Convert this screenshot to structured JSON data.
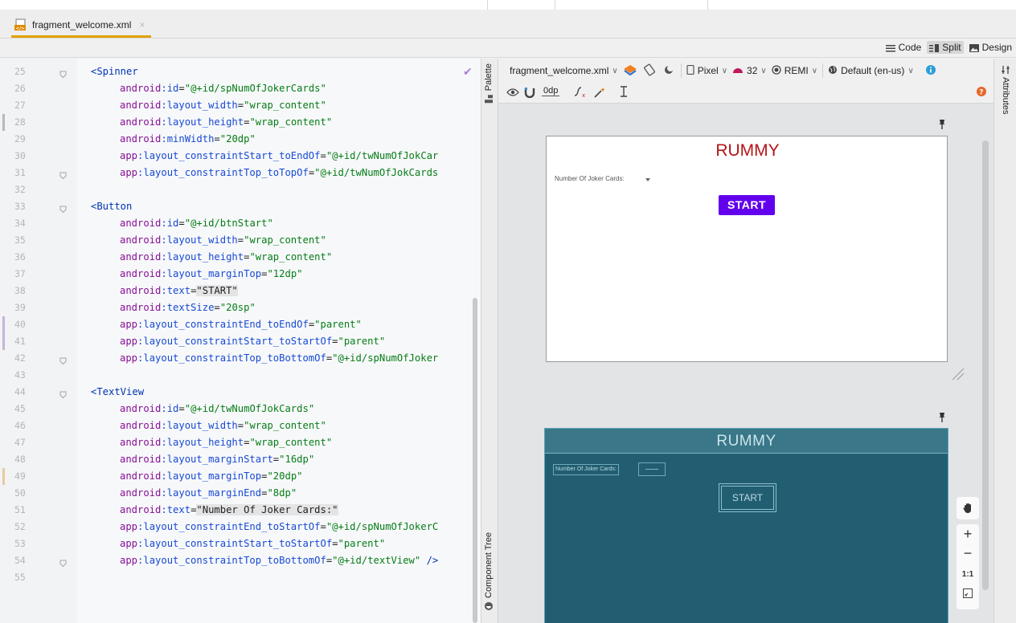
{
  "file_tab": {
    "name": "fragment_welcome.xml",
    "close": "×"
  },
  "view_modes": [
    {
      "label": "Code",
      "icon": "lines-icon",
      "active": false
    },
    {
      "label": "Split",
      "icon": "split-icon",
      "active": true
    },
    {
      "label": "Design",
      "icon": "image-icon",
      "active": false
    }
  ],
  "editor": {
    "lines": [
      {
        "n": "25",
        "parts": [
          [
            "tag",
            "<Spinner"
          ]
        ]
      },
      {
        "n": "26",
        "parts": [
          [
            "ns",
            "android"
          ],
          [
            "attr",
            ":id"
          ],
          [
            "eq",
            "="
          ],
          [
            "val",
            "\"@+id/spNumOfJokerCards\""
          ]
        ]
      },
      {
        "n": "27",
        "parts": [
          [
            "ns",
            "android"
          ],
          [
            "attr",
            ":layout_width"
          ],
          [
            "eq",
            "="
          ],
          [
            "val",
            "\"wrap_content\""
          ]
        ]
      },
      {
        "n": "28",
        "parts": [
          [
            "ns",
            "android"
          ],
          [
            "attr",
            ":layout_height"
          ],
          [
            "eq",
            "="
          ],
          [
            "val",
            "\"wrap_content\""
          ]
        ]
      },
      {
        "n": "29",
        "parts": [
          [
            "ns",
            "android"
          ],
          [
            "attr",
            ":minWidth"
          ],
          [
            "eq",
            "="
          ],
          [
            "val",
            "\"20dp\""
          ]
        ]
      },
      {
        "n": "30",
        "parts": [
          [
            "ns",
            "app"
          ],
          [
            "attr",
            ":layout_constraintStart_toEndOf"
          ],
          [
            "eq",
            "="
          ],
          [
            "val",
            "\"@+id/twNumOfJokCar"
          ]
        ]
      },
      {
        "n": "31",
        "parts": [
          [
            "ns",
            "app"
          ],
          [
            "attr",
            ":layout_constraintTop_toTopOf"
          ],
          [
            "eq",
            "="
          ],
          [
            "val",
            "\"@+id/twNumOfJokCards"
          ]
        ]
      },
      {
        "n": "32",
        "parts": []
      },
      {
        "n": "33",
        "parts": [
          [
            "tag",
            "<Button"
          ]
        ]
      },
      {
        "n": "34",
        "parts": [
          [
            "ns",
            "android"
          ],
          [
            "attr",
            ":id"
          ],
          [
            "eq",
            "="
          ],
          [
            "val",
            "\"@+id/btnStart\""
          ]
        ]
      },
      {
        "n": "35",
        "parts": [
          [
            "ns",
            "android"
          ],
          [
            "attr",
            ":layout_width"
          ],
          [
            "eq",
            "="
          ],
          [
            "val",
            "\"wrap_content\""
          ]
        ]
      },
      {
        "n": "36",
        "parts": [
          [
            "ns",
            "android"
          ],
          [
            "attr",
            ":layout_height"
          ],
          [
            "eq",
            "="
          ],
          [
            "val",
            "\"wrap_content\""
          ]
        ]
      },
      {
        "n": "37",
        "parts": [
          [
            "ns",
            "android"
          ],
          [
            "attr",
            ":layout_marginTop"
          ],
          [
            "eq",
            "="
          ],
          [
            "val",
            "\"12dp\""
          ]
        ]
      },
      {
        "n": "38",
        "parts": [
          [
            "ns",
            "android"
          ],
          [
            "attr",
            ":text"
          ],
          [
            "eq",
            "="
          ],
          [
            "hl",
            "\"START\""
          ]
        ]
      },
      {
        "n": "39",
        "parts": [
          [
            "ns",
            "android"
          ],
          [
            "attr",
            ":textSize"
          ],
          [
            "eq",
            "="
          ],
          [
            "val",
            "\"20sp\""
          ]
        ]
      },
      {
        "n": "40",
        "parts": [
          [
            "ns",
            "app"
          ],
          [
            "attr",
            ":layout_constraintEnd_toEndOf"
          ],
          [
            "eq",
            "="
          ],
          [
            "val",
            "\"parent\""
          ]
        ]
      },
      {
        "n": "41",
        "parts": [
          [
            "ns",
            "app"
          ],
          [
            "attr",
            ":layout_constraintStart_toStartOf"
          ],
          [
            "eq",
            "="
          ],
          [
            "val",
            "\"parent\""
          ]
        ]
      },
      {
        "n": "42",
        "parts": [
          [
            "ns",
            "app"
          ],
          [
            "attr",
            ":layout_constraintTop_toBottomOf"
          ],
          [
            "eq",
            "="
          ],
          [
            "val",
            "\"@+id/spNumOfJoker"
          ]
        ]
      },
      {
        "n": "43",
        "parts": []
      },
      {
        "n": "44",
        "parts": [
          [
            "tag",
            "<TextView"
          ]
        ]
      },
      {
        "n": "45",
        "parts": [
          [
            "ns",
            "android"
          ],
          [
            "attr",
            ":id"
          ],
          [
            "eq",
            "="
          ],
          [
            "val",
            "\"@+id/twNumOfJokCards\""
          ]
        ]
      },
      {
        "n": "46",
        "parts": [
          [
            "ns",
            "android"
          ],
          [
            "attr",
            ":layout_width"
          ],
          [
            "eq",
            "="
          ],
          [
            "val",
            "\"wrap_content\""
          ]
        ]
      },
      {
        "n": "47",
        "parts": [
          [
            "ns",
            "android"
          ],
          [
            "attr",
            ":layout_height"
          ],
          [
            "eq",
            "="
          ],
          [
            "val",
            "\"wrap_content\""
          ]
        ]
      },
      {
        "n": "48",
        "parts": [
          [
            "ns",
            "android"
          ],
          [
            "attr",
            ":layout_marginStart"
          ],
          [
            "eq",
            "="
          ],
          [
            "val",
            "\"16dp\""
          ]
        ]
      },
      {
        "n": "49",
        "parts": [
          [
            "ns",
            "android"
          ],
          [
            "attr",
            ":layout_marginTop"
          ],
          [
            "eq",
            "="
          ],
          [
            "val",
            "\"20dp\""
          ]
        ]
      },
      {
        "n": "50",
        "parts": [
          [
            "ns",
            "android"
          ],
          [
            "attr",
            ":layout_marginEnd"
          ],
          [
            "eq",
            "="
          ],
          [
            "val",
            "\"8dp\""
          ]
        ]
      },
      {
        "n": "51",
        "parts": [
          [
            "ns",
            "android"
          ],
          [
            "attr",
            ":text"
          ],
          [
            "eq",
            "="
          ],
          [
            "hl",
            "\"Number Of Joker Cards:\""
          ]
        ]
      },
      {
        "n": "52",
        "parts": [
          [
            "ns",
            "app"
          ],
          [
            "attr",
            ":layout_constraintEnd_toStartOf"
          ],
          [
            "eq",
            "="
          ],
          [
            "val",
            "\"@+id/spNumOfJokerC"
          ]
        ]
      },
      {
        "n": "53",
        "parts": [
          [
            "ns",
            "app"
          ],
          [
            "attr",
            ":layout_constraintStart_toStartOf"
          ],
          [
            "eq",
            "="
          ],
          [
            "val",
            "\"parent\""
          ]
        ]
      },
      {
        "n": "54",
        "parts": [
          [
            "ns",
            "app"
          ],
          [
            "attr",
            ":layout_constraintTop_toBottomOf"
          ],
          [
            "eq",
            "="
          ],
          [
            "val",
            "\"@+id/textView\""
          ],
          [
            "tag",
            " />"
          ]
        ]
      },
      {
        "n": "55",
        "parts": []
      }
    ],
    "fold_lines": [
      "25",
      "31",
      "33",
      "42",
      "44",
      "54"
    ],
    "marked_lines": {
      "28": "#b9b9b9",
      "40": "#c7b4d8",
      "41": "#c7b4d8",
      "49": "#e8c9a0"
    }
  },
  "left_strip": {
    "palette": "Palette",
    "component_tree": "Component Tree"
  },
  "right_strip": {
    "attributes": "Attributes"
  },
  "design_toolbar": {
    "file": "fragment_welcome.xml",
    "device": "Pixel",
    "api": "32",
    "theme": "REMI",
    "locale": "Default (en-us)",
    "margin": "0dp"
  },
  "preview": {
    "title": "RUMMY",
    "label": "Number Of Joker Cards:",
    "button": "START"
  },
  "blueprint": {
    "title": "RUMMY",
    "label": "Number Of Joker Cards:",
    "button": "START"
  },
  "zoom": {
    "plus": "+",
    "minus": "−",
    "one_to_one": "1:1"
  },
  "colors": {
    "accent_orange": "#e0a000",
    "button_purple": "#6200ee",
    "title_red": "#b41419",
    "blueprint_bg": "#225e72"
  }
}
